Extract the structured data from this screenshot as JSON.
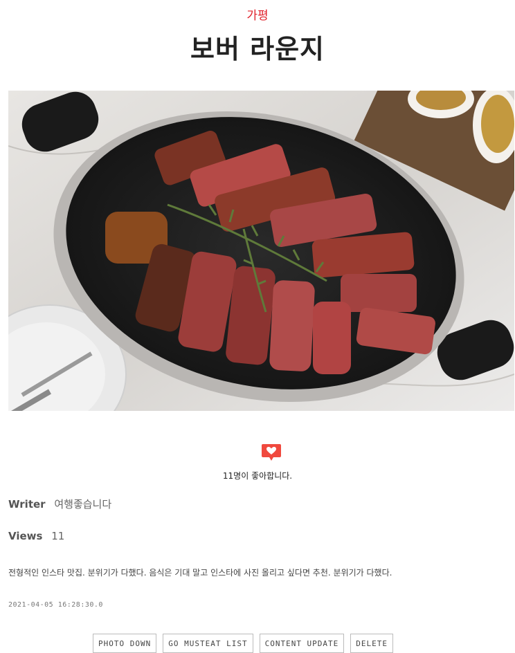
{
  "post": {
    "region": "가평",
    "title": "보버 라운지",
    "likes_text": "11명이 좋아합니다.",
    "writer_label": "Writer",
    "writer": "여행좋습니다",
    "views_label": "Views",
    "views": "11",
    "content": "전형적인 인스타 맛집. 분위기가 다했다. 음식은 기대 말고 인스타에 사진 올리고 싶다면 추천. 분위기가 다했다.",
    "date": "2021-04-05 16:28:30.0"
  },
  "buttons": {
    "photo_down": "PHOTO DOWN",
    "go_list": "GO MUSTEAT LIST",
    "update": "CONTENT UPDATE",
    "delete": "DELETE"
  },
  "icons": {
    "like": "heart-speech-bubble-icon"
  },
  "colors": {
    "accent": "#e0202a",
    "like_icon": "#f0493e"
  }
}
